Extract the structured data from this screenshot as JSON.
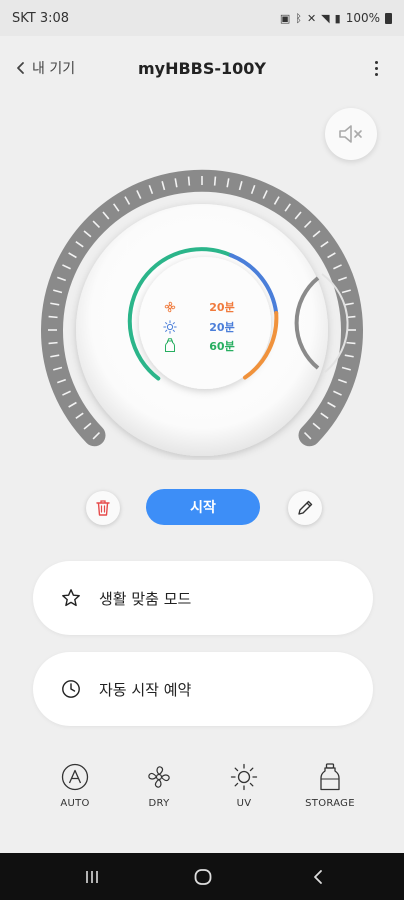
{
  "status_bar": {
    "carrier_time": "SKT 3:08",
    "battery": "100%",
    "icons": [
      "cellular-data-icon",
      "bluetooth-icon",
      "mute-icon",
      "wifi-icon",
      "signal-icon",
      "battery-icon"
    ]
  },
  "header": {
    "back_label": "내 기기",
    "title": "myHBBS-100Y",
    "more_icon": "more-vertical-icon"
  },
  "mute_button": {
    "icon": "speaker-mute-icon"
  },
  "dial": {
    "modes": [
      {
        "icon": "fan-icon",
        "value": "20분",
        "color": "#f07a3c"
      },
      {
        "icon": "uv-sun-icon",
        "value": "20분",
        "color": "#4a7ed9"
      },
      {
        "icon": "bottle-icon",
        "value": "60분",
        "color": "#27ae60"
      }
    ],
    "ring_colors": {
      "green": "#2bb58a",
      "blue": "#4a7ed9",
      "orange": "#f0923c",
      "track": "#8a8a8a"
    }
  },
  "actions": {
    "delete_icon": "trash-icon",
    "start_label": "시작",
    "edit_icon": "pencil-icon",
    "accent": "#3d8ef7",
    "delete_color": "#e64b4b"
  },
  "cards": [
    {
      "icon": "star-icon",
      "label": "생활 맞춤 모드"
    },
    {
      "icon": "clock-icon",
      "label": "자동 시작 예약"
    }
  ],
  "bottom_nav": [
    {
      "icon": "auto-icon",
      "label": "AUTO"
    },
    {
      "icon": "fan-icon",
      "label": "DRY"
    },
    {
      "icon": "uv-sun-icon",
      "label": "UV"
    },
    {
      "icon": "bottle-icon",
      "label": "STORAGE"
    }
  ],
  "system_nav": [
    "recents-icon",
    "home-icon",
    "back-icon"
  ]
}
